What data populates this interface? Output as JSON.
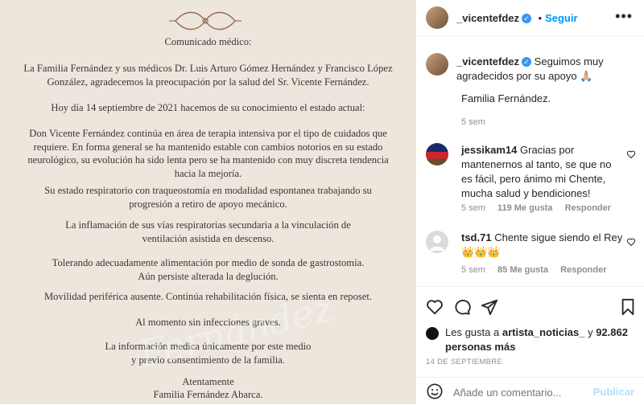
{
  "post_image": {
    "letter": {
      "title": "Comunicado médico:",
      "p1": [
        "La Familia Fernández y sus médicos Dr. Luis Arturo Gómez Hernández y Francisco López",
        "González, agradecemos la preocupación por la salud del Sr. Vicente Fernández."
      ],
      "p2": "Hoy día 14 septiembre de 2021 hacemos de su conocimiento el estado actual:",
      "p3": [
        "Don Vicente Fernández continúa en área de terapia intensiva por el tipo de cuidados que",
        "requiere. En forma general se ha mantenido estable con cambios notorios en su estado",
        "neurológico, su evolución ha sido lenta pero se ha mantenido con muy discreta tendencia",
        "hacia la mejoría."
      ],
      "p4": [
        "Su estado respiratorio con traqueostomía en modalidad espontanea trabajando su",
        "progresión a retiro de apoyo mecánico."
      ],
      "p5": [
        "La inflamación de sus vías respiratorias secundaria a la vinculación de",
        "ventilación asistida en descenso."
      ],
      "p6": [
        "Tolerando adecuadamente alimentación por medio de sonda de gastrostomía.",
        "Aún persiste alterada la deglución."
      ],
      "p7": "Movilidad periférica ausente. Continúa rehabilitación física, se sienta en reposet.",
      "p8": "Al momento sin infecciones graves.",
      "p9": [
        "La información medica únicamente por este medio",
        "y previo consentimiento de la familia."
      ],
      "closing": "Atentamente",
      "signature": "Familia Fernández Abarca."
    },
    "watermark": "Fernández"
  },
  "header": {
    "username": "_vicentefdez",
    "follow_label": "Seguir",
    "more_icon": "more-horizontal-icon"
  },
  "caption": {
    "username": "_vicentefdez",
    "text": "Seguimos muy agradecidos por su apoyo 🙏🏼",
    "signature": "Familia Fernández.",
    "time": "5 sem"
  },
  "comments": [
    {
      "username": "jessikam14",
      "text": "Gracias por mantenernos al tanto, se que no es fácil, pero ánimo mi Chente, mucha salud y bendiciones!",
      "time": "5 sem",
      "likes": "119 Me gusta",
      "reply": "Responder"
    },
    {
      "username": "tsd.71",
      "text": "Chente sigue siendo el Rey 👑👑👑",
      "time": "5 sem",
      "likes": "85 Me gusta",
      "reply": "Responder"
    }
  ],
  "likes": {
    "prefix": "Les gusta a",
    "user": "artista_noticias_",
    "conj": "y",
    "count": "92.862 personas más"
  },
  "post_date": "14 DE SEPTIEMBRE",
  "add_comment": {
    "placeholder": "Añade un comentario...",
    "publish_label": "Publicar"
  },
  "colors": {
    "link_blue": "#0095f6",
    "verified_blue": "#3897f0",
    "muted": "#8e8e8e",
    "paper": "#ece6dd"
  }
}
